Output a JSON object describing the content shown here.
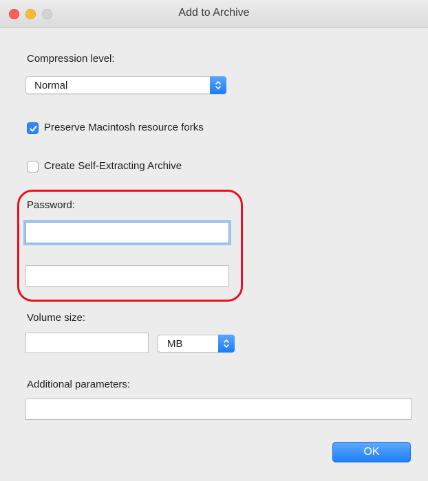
{
  "window": {
    "title": "Add to Archive"
  },
  "compression": {
    "label": "Compression level:",
    "selected": "Normal"
  },
  "options": {
    "preserve_forks": {
      "label": "Preserve Macintosh resource forks",
      "checked": true
    },
    "self_extracting": {
      "label": "Create Self-Extracting Archive",
      "checked": false
    }
  },
  "password": {
    "label": "Password:",
    "value": "",
    "confirm_value": ""
  },
  "volume": {
    "label": "Volume size:",
    "value": "",
    "unit": "MB"
  },
  "additional": {
    "label": "Additional parameters:",
    "value": ""
  },
  "buttons": {
    "ok_label": "OK"
  },
  "colors": {
    "accent": "#2d88fb",
    "highlight": "#e8101b"
  }
}
